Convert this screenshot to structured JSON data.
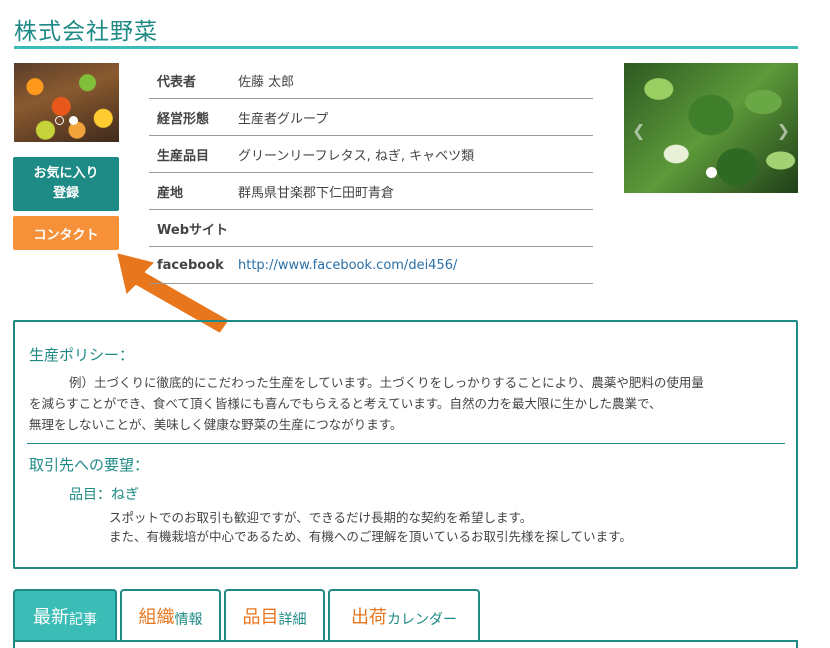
{
  "header": {
    "company_name": "株式会社野菜"
  },
  "buttons": {
    "favorite": "お気に入り登録",
    "contact": "コンタクト"
  },
  "profile": [
    {
      "label": "代表者",
      "value": "佐藤 太郎"
    },
    {
      "label": "経営形態",
      "value": "生産者グループ"
    },
    {
      "label": "生産品目",
      "value": "グリーンリーフレタス, ねぎ, キャベツ類"
    },
    {
      "label": "産地",
      "value": "群馬県甘楽郡下仁田町青倉"
    },
    {
      "label": "Webサイト",
      "value": ""
    },
    {
      "label": "facebook",
      "value": "http://www.facebook.com/dei456/"
    }
  ],
  "policy": {
    "heading": "生産ポリシー：",
    "lines": [
      "例）土づくりに徹底的にこだわった生産をしています。土づくりをしっかりすることにより、農薬や肥料の使用量",
      "を減らすことができ、食べて頂く皆様にも喜んでもらえると考えています。自然の力を最大限に生かした農業で、",
      "無理をしないことが、美味しく健康な野菜の生産につながります。"
    ]
  },
  "requests": {
    "heading": "取引先への要望：",
    "product": "品目：ねぎ",
    "lines": [
      "スポットでのお取引も歓迎ですが、できるだけ長期的な契約を希望します。",
      "また、有機栽培が中心であるため、有機へのご理解を頂いているお取引先様を探しています。"
    ]
  },
  "tabs": [
    {
      "big": "最新",
      "small": "記事",
      "active": true
    },
    {
      "big": "組織",
      "small": "情報",
      "active": false
    },
    {
      "big": "品目",
      "small": "詳細",
      "active": false
    },
    {
      "big": "出荷",
      "small": "カレンダー",
      "active": false
    }
  ],
  "icons": {
    "left_arrow": "chevron-left-icon",
    "right_arrow": "chevron-right-icon",
    "annotation": "orange-arrow"
  },
  "colors": {
    "teal": "#1e8a86",
    "teal_light": "#3cbcb7",
    "orange": "#f6913a",
    "arrow": "#e8761c"
  }
}
